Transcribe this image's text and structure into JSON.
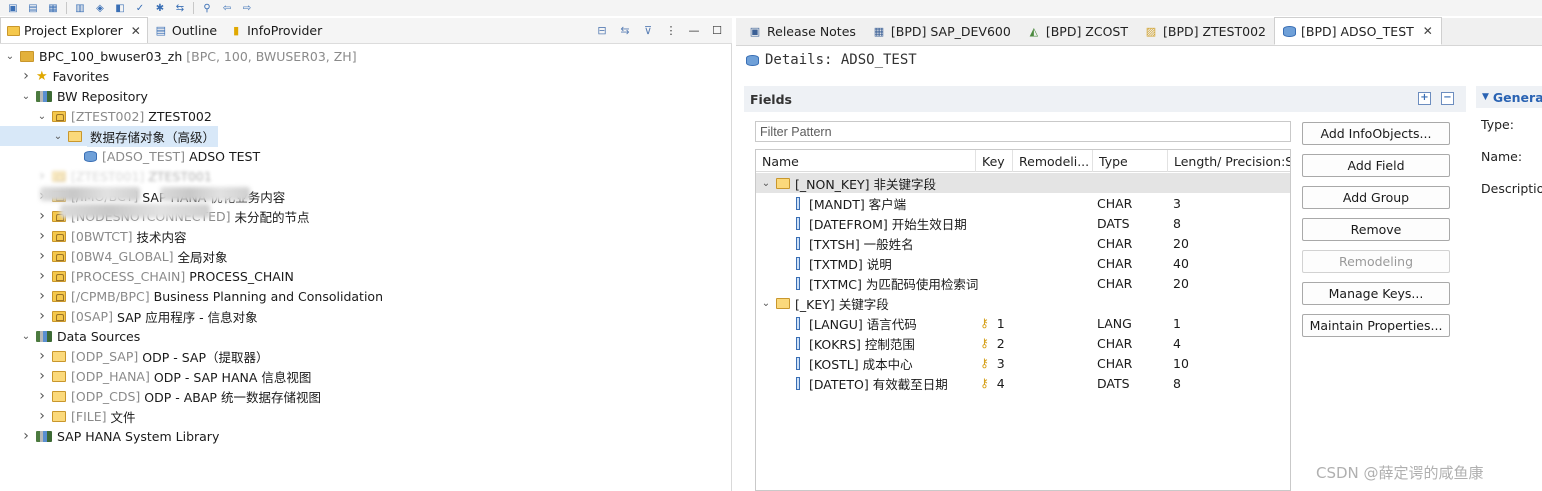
{
  "left_view": {
    "tabs": [
      {
        "label": "Project Explorer",
        "active": true
      },
      {
        "label": "Outline",
        "active": false
      },
      {
        "label": "InfoProvider",
        "active": false
      }
    ],
    "tree": [
      {
        "depth": 0,
        "expanded": true,
        "icon": "project-icon",
        "tech": "",
        "label": "BPC_100_bwuser03_zh",
        "suffix": "[BPC, 100, BWUSER03, ZH]"
      },
      {
        "depth": 1,
        "expanded": false,
        "icon": "star-icon",
        "tech": "",
        "label": "Favorites",
        "suffix": ""
      },
      {
        "depth": 1,
        "expanded": true,
        "icon": "repository-icon",
        "tech": "",
        "label": "BW Repository",
        "suffix": ""
      },
      {
        "depth": 2,
        "expanded": true,
        "icon": "package-folder-icon",
        "tech": "[ZTEST002]",
        "label": "ZTEST002",
        "suffix": ""
      },
      {
        "depth": 3,
        "expanded": true,
        "icon": "open-folder-icon",
        "tech": "",
        "label": "数据存储对象（高级）",
        "suffix": "",
        "selected": true
      },
      {
        "depth": 4,
        "expanded": null,
        "icon": "adso-icon",
        "tech": "[ADSO_TEST]",
        "label": "ADSO TEST",
        "suffix": ""
      },
      {
        "depth": 2,
        "expanded": false,
        "icon": "package-folder-icon",
        "tech": "[ZTEST001]",
        "label": "ZTEST001",
        "suffix": "",
        "obscured": true
      },
      {
        "depth": 2,
        "expanded": false,
        "icon": "package-folder-icon",
        "tech": "[/IMO/BCT]",
        "label": "SAP HANA 优化业务内容",
        "suffix": ""
      },
      {
        "depth": 2,
        "expanded": false,
        "icon": "package-folder-icon",
        "tech": "[NODESNOTCONNECTED]",
        "label": "未分配的节点",
        "suffix": ""
      },
      {
        "depth": 2,
        "expanded": false,
        "icon": "package-folder-icon",
        "tech": "[0BWTCT]",
        "label": "技术内容",
        "suffix": ""
      },
      {
        "depth": 2,
        "expanded": false,
        "icon": "package-folder-icon",
        "tech": "[0BW4_GLOBAL]",
        "label": "全局对象",
        "suffix": ""
      },
      {
        "depth": 2,
        "expanded": false,
        "icon": "package-folder-icon",
        "tech": "[PROCESS_CHAIN]",
        "label": "PROCESS_CHAIN",
        "suffix": ""
      },
      {
        "depth": 2,
        "expanded": false,
        "icon": "package-folder-icon",
        "tech": "[/CPMB/BPC]",
        "label": "Business Planning and Consolidation",
        "suffix": ""
      },
      {
        "depth": 2,
        "expanded": false,
        "icon": "package-folder-icon",
        "tech": "[0SAP]",
        "label": "SAP 应用程序 - 信息对象",
        "suffix": ""
      },
      {
        "depth": 1,
        "expanded": true,
        "icon": "repository-icon",
        "tech": "",
        "label": "Data Sources",
        "suffix": ""
      },
      {
        "depth": 2,
        "expanded": false,
        "icon": "open-folder-icon",
        "tech": "[ODP_SAP]",
        "label": "ODP - SAP（提取器）",
        "suffix": ""
      },
      {
        "depth": 2,
        "expanded": false,
        "icon": "open-folder-icon",
        "tech": "[ODP_HANA]",
        "label": "ODP - SAP HANA 信息视图",
        "suffix": ""
      },
      {
        "depth": 2,
        "expanded": false,
        "icon": "open-folder-icon",
        "tech": "[ODP_CDS]",
        "label": "ODP - ABAP 统一数据存储视图",
        "suffix": ""
      },
      {
        "depth": 2,
        "expanded": false,
        "icon": "open-folder-icon",
        "tech": "[FILE]",
        "label": "文件",
        "suffix": ""
      },
      {
        "depth": 1,
        "expanded": false,
        "icon": "repository-icon",
        "tech": "",
        "label": "SAP HANA System Library",
        "suffix": ""
      }
    ]
  },
  "editor": {
    "tabs": [
      {
        "label": "Release Notes",
        "icon": "release-notes-icon",
        "active": false
      },
      {
        "label": "[BPD] SAP_DEV600",
        "icon": "system-icon",
        "active": false
      },
      {
        "label": "[BPD] ZCOST",
        "icon": "infocube-icon",
        "active": false
      },
      {
        "label": "[BPD] ZTEST002",
        "icon": "package-icon",
        "active": false
      },
      {
        "label": "[BPD] ADSO_TEST",
        "icon": "adso-icon",
        "active": true
      }
    ],
    "title": "Details: ADSO_TEST",
    "fields_section": "Fields",
    "filter_placeholder": "Filter Pattern",
    "columns": [
      "Name",
      "Key",
      "Remodeli...",
      "Type",
      "Length/ Precision:Sc"
    ],
    "groups": [
      {
        "label": "[_NON_KEY] 非关键字段",
        "fields": [
          {
            "name": "[MANDT] 客户端",
            "key": "",
            "type": "CHAR",
            "length": "3"
          },
          {
            "name": "[DATEFROM] 开始生效日期",
            "key": "",
            "type": "DATS",
            "length": "8"
          },
          {
            "name": "[TXTSH] 一般姓名",
            "key": "",
            "type": "CHAR",
            "length": "20"
          },
          {
            "name": "[TXTMD] 说明",
            "key": "",
            "type": "CHAR",
            "length": "40"
          },
          {
            "name": "[TXTMC] 为匹配码使用检索词",
            "key": "",
            "type": "CHAR",
            "length": "20"
          }
        ]
      },
      {
        "label": "[_KEY] 关键字段",
        "fields": [
          {
            "name": "[LANGU] 语言代码",
            "key": "1",
            "type": "LANG",
            "length": "1"
          },
          {
            "name": "[KOKRS] 控制范围",
            "key": "2",
            "type": "CHAR",
            "length": "4"
          },
          {
            "name": "[KOSTL] 成本中心",
            "key": "3",
            "type": "CHAR",
            "length": "10"
          },
          {
            "name": "[DATETO] 有效截至日期",
            "key": "4",
            "type": "DATS",
            "length": "8"
          }
        ]
      }
    ],
    "buttons": [
      {
        "label": "Add InfoObjects...",
        "enabled": true
      },
      {
        "label": "Add Field",
        "enabled": true
      },
      {
        "label": "Add Group",
        "enabled": true
      },
      {
        "label": "Remove",
        "enabled": true
      },
      {
        "label": "Remodeling",
        "enabled": false
      },
      {
        "label": "Manage Keys...",
        "enabled": true
      },
      {
        "label": "Maintain Properties...",
        "enabled": true
      }
    ],
    "general": {
      "title": "General",
      "labels": [
        "Type:",
        "Name:",
        "Description:"
      ]
    }
  },
  "watermark": "CSDN @薛定谔的咸鱼康",
  "colors": {
    "selection": "#d8e8f8",
    "section_header": "#eef1f5",
    "group_row": "#e4e4e4",
    "tech_text": "#8a8a8a",
    "accent": "#2a63b3"
  }
}
